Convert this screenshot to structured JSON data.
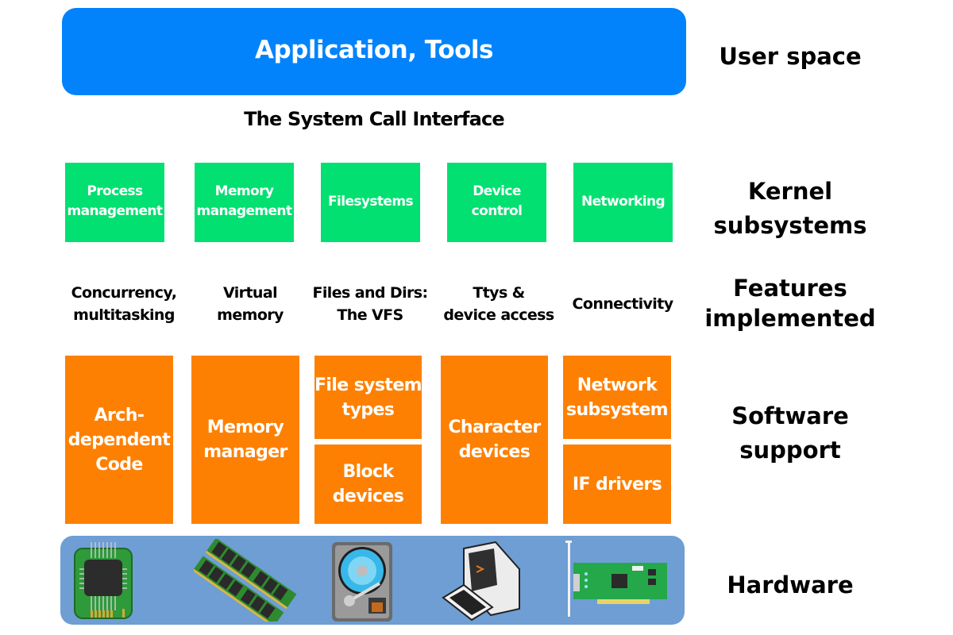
{
  "user_space": {
    "box_label": "Application, Tools",
    "interface_label": "The System Call Interface"
  },
  "kernel_subsystems": [
    {
      "label": "Process\nmanagement"
    },
    {
      "label": "Memory\nmanagement"
    },
    {
      "label": "Filesystems"
    },
    {
      "label": "Device\ncontrol"
    },
    {
      "label": "Networking"
    }
  ],
  "features": [
    {
      "label": "Concurrency,\nmultitasking"
    },
    {
      "label": "Virtual\nmemory"
    },
    {
      "label": "Files and Dirs:\nThe VFS"
    },
    {
      "label": "Ttys &\ndevice access"
    },
    {
      "label": "Connectivity"
    }
  ],
  "software_support": {
    "arch": "Arch-\ndependent\nCode",
    "memory_manager": "Memory\nmanager",
    "fs_types": "File system\ntypes",
    "block_devices": "Block\ndevices",
    "char_devices": "Character\ndevices",
    "network_subsystem": "Network\nsubsystem",
    "if_drivers": "IF drivers"
  },
  "hardware_icons": [
    "cpu-chip-icon",
    "ram-module-icon",
    "hard-disk-icon",
    "terminal-computer-icon",
    "network-card-icon"
  ],
  "layer_labels": {
    "user_space": "User space",
    "kernel_subsystems": "Kernel\nsubsystems",
    "features_implemented": "Features\nimplemented",
    "software_support": "Software\nsupport",
    "hardware": "Hardware"
  },
  "colors": {
    "user_space": "#0283fb",
    "kernel_subsystem": "#01e070",
    "software_support": "#fe8002",
    "hardware": "#6e9ed3"
  }
}
